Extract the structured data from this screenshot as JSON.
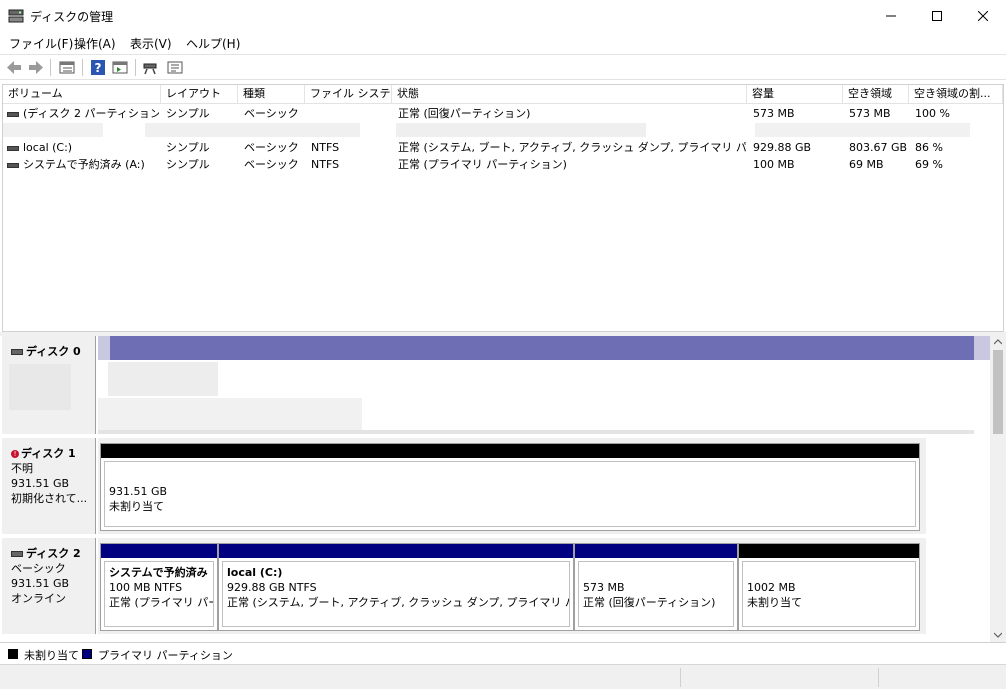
{
  "window": {
    "title": "ディスクの管理",
    "minimize": "—",
    "maximize": "☐",
    "close": "✕"
  },
  "menu": [
    {
      "label": "ファイル(F)"
    },
    {
      "label": "操作(A)"
    },
    {
      "label": "表示(V)"
    },
    {
      "label": "ヘルプ(H)"
    }
  ],
  "toolbar_icons": [
    "back-arrow-icon",
    "forward-arrow-icon",
    "list-view-icon",
    "help-icon",
    "console-icon",
    "disk-connect-icon",
    "properties-icon"
  ],
  "volume_table": {
    "columns": [
      "ボリューム",
      "レイアウト",
      "種類",
      "ファイル システム",
      "状態",
      "容量",
      "空き領域",
      "空き領域の割..."
    ],
    "rows": [
      {
        "volume": "(ディスク 2 パーティション 3)",
        "layout": "シンプル",
        "type": "ベーシック",
        "fs": "",
        "status": "正常 (回復パーティション)",
        "capacity": "573 MB",
        "free": "573 MB",
        "pct": "100 %"
      },
      {
        "volume": "local (C:)",
        "layout": "シンプル",
        "type": "ベーシック",
        "fs": "NTFS",
        "status": "正常 (システム, ブート, アクティブ, クラッシュ ダンプ, プライマリ パーティション)",
        "capacity": "929.88 GB",
        "free": "803.67 GB",
        "pct": "86 %"
      },
      {
        "volume": "システムで予約済み (A:)",
        "layout": "シンプル",
        "type": "ベーシック",
        "fs": "NTFS",
        "status": "正常 (プライマリ パーティション)",
        "capacity": "100 MB",
        "free": "69 MB",
        "pct": "69 %"
      }
    ]
  },
  "disks": {
    "disk0": {
      "name": "ディスク 0"
    },
    "disk1": {
      "name": "ディスク 1",
      "type": "不明",
      "size": "931.51 GB",
      "status": "初期化されて...",
      "partition": {
        "size": "931.51 GB",
        "status": "未割り当て"
      }
    },
    "disk2": {
      "name": "ディスク 2",
      "type": "ベーシック",
      "size": "931.51 GB",
      "status": "オンライン",
      "partitions": [
        {
          "name": "システムで予約済み",
          "size": "100 MB NTFS",
          "status": "正常 (プライマリ パーテ"
        },
        {
          "name": "local  (C:)",
          "size": "929.88 GB NTFS",
          "status": "正常 (システム, ブート, アクティブ, クラッシュ ダンプ, プライマリ パーティション"
        },
        {
          "name": "",
          "size": "573 MB",
          "status": "正常 (回復パーティション)"
        },
        {
          "name": "",
          "size": "1002 MB",
          "status": "未割り当て"
        }
      ]
    }
  },
  "legend": [
    {
      "label": "未割り当て",
      "color": "#000000"
    },
    {
      "label": "プライマリ パーティション",
      "color": "#000080"
    }
  ],
  "colors": {
    "primary": "#000080",
    "unallocated": "#000000",
    "disk0_bar": "#6e6eb4"
  }
}
